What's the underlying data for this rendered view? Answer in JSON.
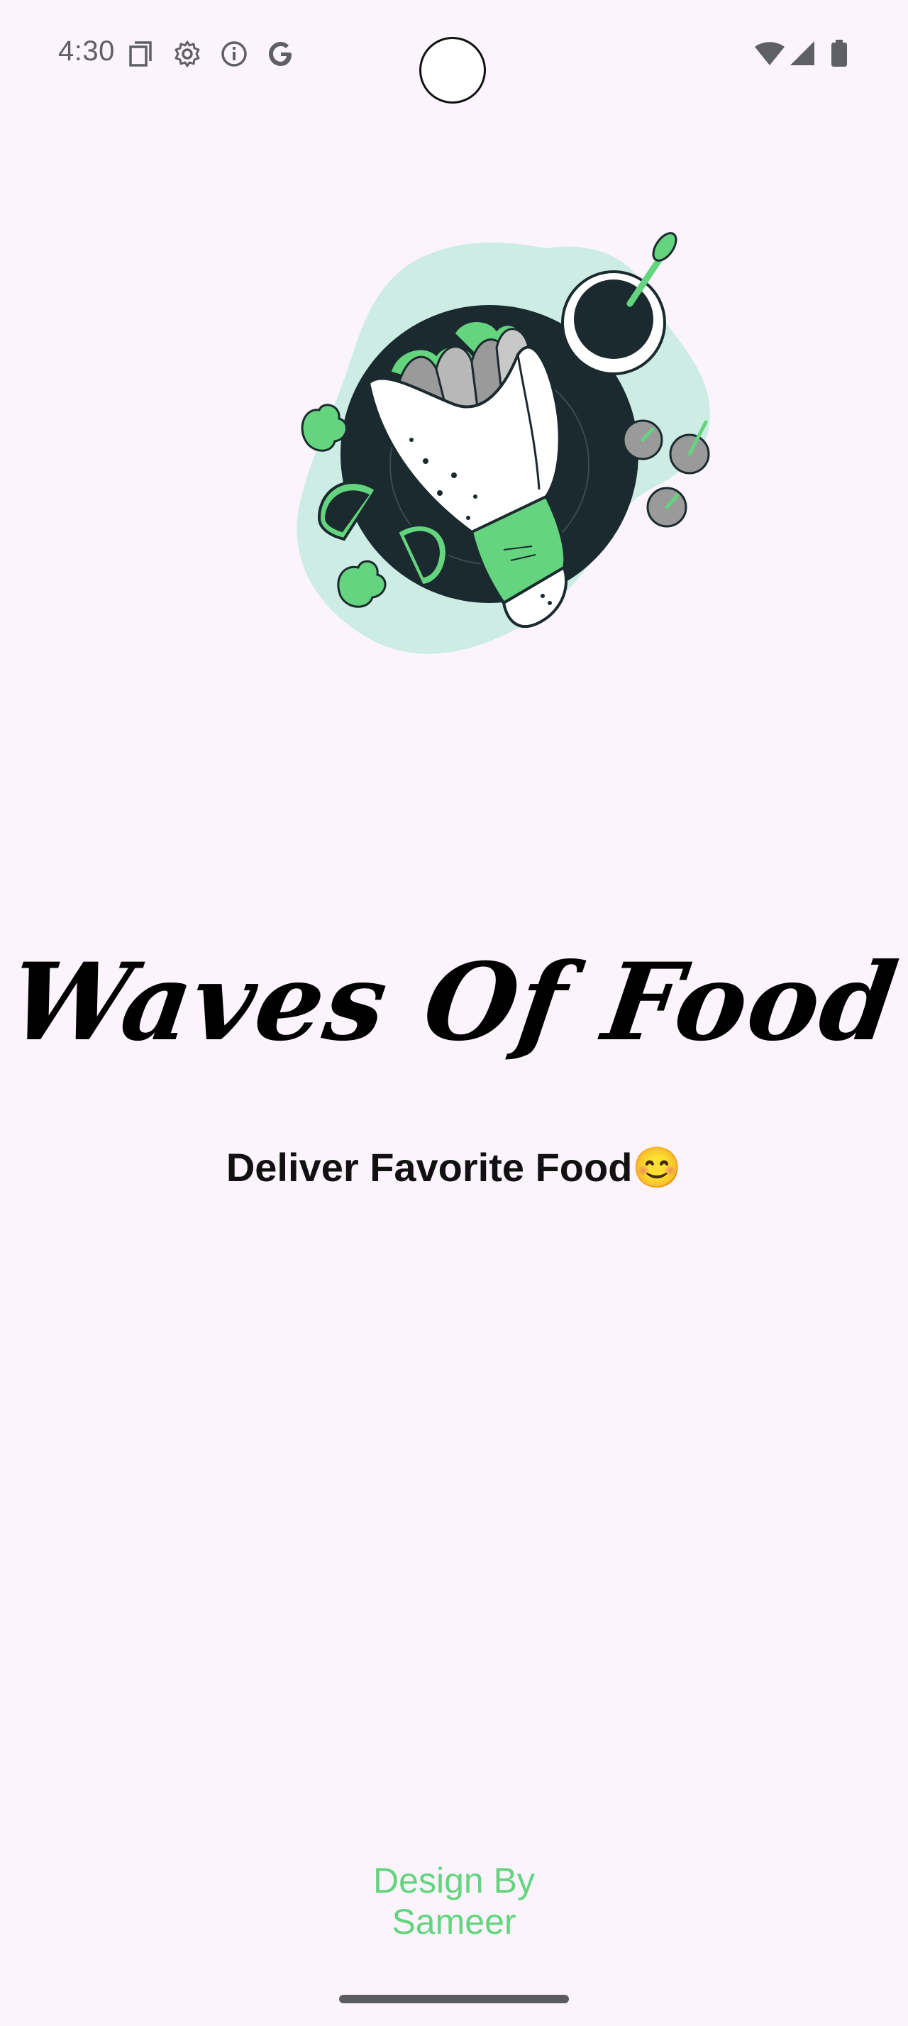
{
  "status_bar": {
    "time": "4:30",
    "left_icons": [
      "sim-card-icon",
      "gear-icon",
      "info-icon",
      "google-icon"
    ],
    "right_icons": [
      "wifi-icon",
      "signal-icon",
      "battery-icon"
    ]
  },
  "splash": {
    "illustration": "food-wrap-plate-icon",
    "title": "Waves Of Food",
    "tagline": "Deliver Favorite Food😊",
    "credit_line1": "Design By",
    "credit_line2": "Sameer"
  },
  "colors": {
    "background": "#FCF4FC",
    "accent_green": "#64D47F",
    "mint_blob": "#CDEDE4",
    "dark_plate": "#1A2A2E"
  }
}
